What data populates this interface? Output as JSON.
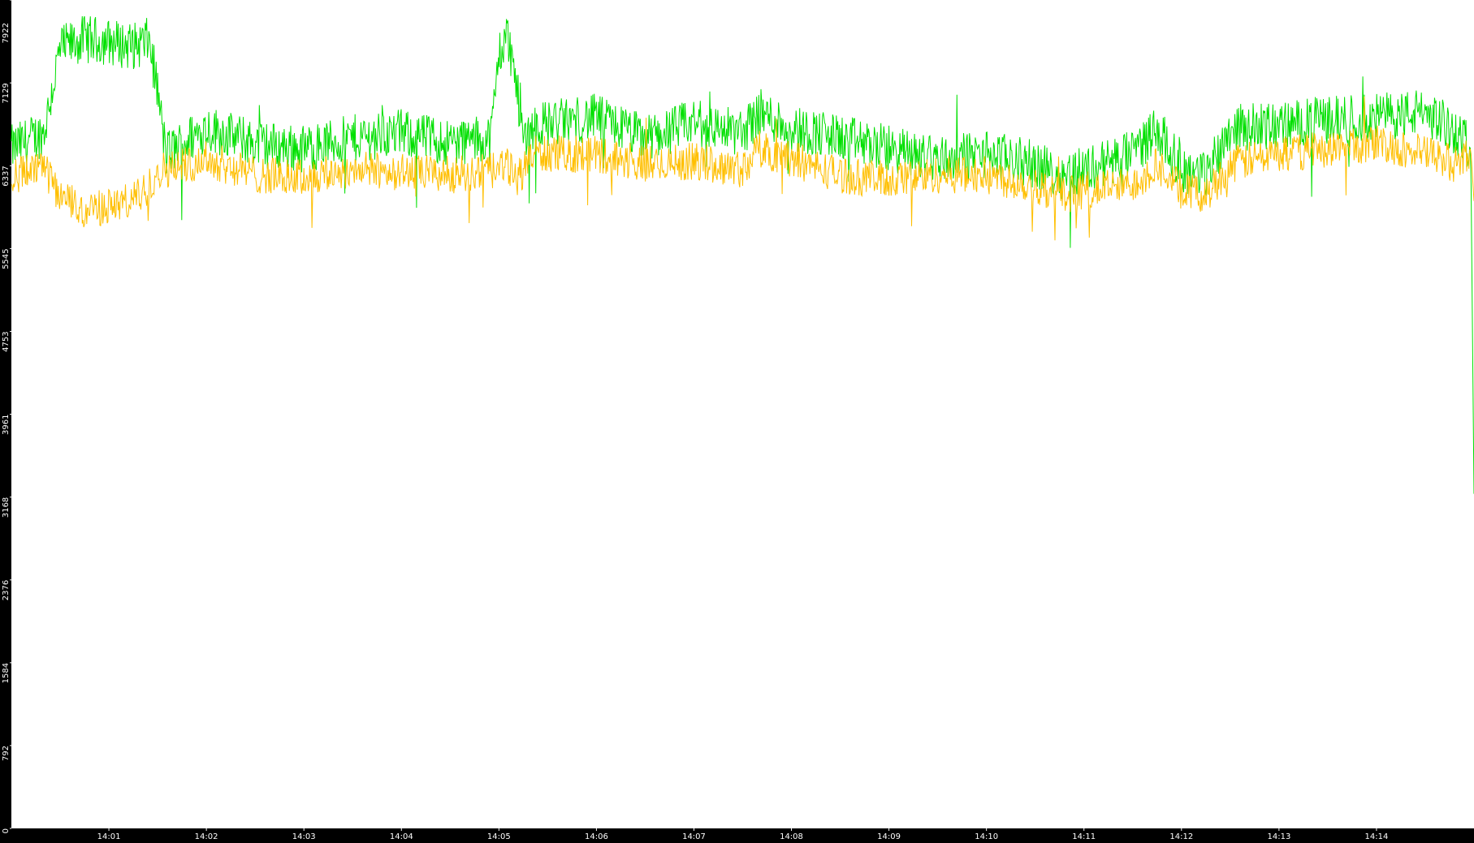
{
  "chart_data": {
    "type": "line",
    "title": "",
    "xlabel": "",
    "ylabel": "",
    "ylim": [
      0,
      7922
    ],
    "xlim": [
      "14:00:00",
      "14:15:00"
    ],
    "grid": false,
    "legend": "none",
    "background": "#ffffff",
    "frame": "#000000",
    "y_ticks": [
      0,
      792,
      1584,
      2376,
      3168,
      3961,
      4753,
      5545,
      6337,
      7129,
      7922
    ],
    "x_ticks": [
      "14:01",
      "14:02",
      "14:03",
      "14:04",
      "14:05",
      "14:06",
      "14:07",
      "14:08",
      "14:09",
      "14:10",
      "14:11",
      "14:12",
      "14:13",
      "14:14"
    ],
    "series": [
      {
        "color": "#00e000",
        "noise": 230,
        "x": [
          "14:00:00",
          "14:00:20",
          "14:00:30",
          "14:00:45",
          "14:01:00",
          "14:01:15",
          "14:01:25",
          "14:01:30",
          "14:01:35",
          "14:02:00",
          "14:02:30",
          "14:03:00",
          "14:03:30",
          "14:04:00",
          "14:04:30",
          "14:04:55",
          "14:05:00",
          "14:05:05",
          "14:05:10",
          "14:05:15",
          "14:05:20",
          "14:06:00",
          "14:06:30",
          "14:07:00",
          "14:07:30",
          "14:07:40",
          "14:08:00",
          "14:08:30",
          "14:09:00",
          "14:09:30",
          "14:10:00",
          "14:10:30",
          "14:10:45",
          "14:11:00",
          "14:11:30",
          "14:11:45",
          "14:12:00",
          "14:12:15",
          "14:12:20",
          "14:12:30",
          "14:13:00",
          "14:13:30",
          "14:14:00",
          "14:14:30",
          "14:14:50",
          "14:14:58",
          "14:15:00"
        ],
        "values": [
          6500,
          6650,
          7450,
          7550,
          7520,
          7480,
          7530,
          7050,
          6450,
          6700,
          6550,
          6500,
          6600,
          6650,
          6560,
          6600,
          7400,
          7600,
          7200,
          6600,
          6720,
          6800,
          6600,
          6750,
          6650,
          6850,
          6700,
          6600,
          6500,
          6400,
          6450,
          6350,
          6250,
          6300,
          6450,
          6700,
          6300,
          6250,
          6400,
          6700,
          6720,
          6780,
          6800,
          6850,
          6650,
          6500,
          3200
        ]
      },
      {
        "color": "#ffbf00",
        "noise": 180,
        "x": [
          "14:00:00",
          "14:00:20",
          "14:00:30",
          "14:00:45",
          "14:01:00",
          "14:01:15",
          "14:01:25",
          "14:01:30",
          "14:01:35",
          "14:02:00",
          "14:02:30",
          "14:03:00",
          "14:03:30",
          "14:04:00",
          "14:04:30",
          "14:04:55",
          "14:05:00",
          "14:05:05",
          "14:05:10",
          "14:05:15",
          "14:05:20",
          "14:06:00",
          "14:06:30",
          "14:07:00",
          "14:07:30",
          "14:07:40",
          "14:08:00",
          "14:08:30",
          "14:09:00",
          "14:09:30",
          "14:10:00",
          "14:10:30",
          "14:10:45",
          "14:11:00",
          "14:11:30",
          "14:11:45",
          "14:12:00",
          "14:12:15",
          "14:12:20",
          "14:12:30",
          "14:13:00",
          "14:13:30",
          "14:14:00",
          "14:14:30",
          "14:14:50",
          "14:14:58",
          "14:15:00"
        ],
        "values": [
          6250,
          6300,
          6050,
          5900,
          5950,
          6000,
          6150,
          6300,
          6300,
          6400,
          6250,
          6220,
          6300,
          6280,
          6250,
          6280,
          6300,
          6350,
          6200,
          6300,
          6450,
          6450,
          6350,
          6380,
          6300,
          6500,
          6400,
          6250,
          6200,
          6250,
          6250,
          6150,
          6050,
          6100,
          6150,
          6350,
          6100,
          6050,
          6150,
          6350,
          6450,
          6500,
          6550,
          6450,
          6350,
          6500,
          6000
        ]
      }
    ]
  }
}
